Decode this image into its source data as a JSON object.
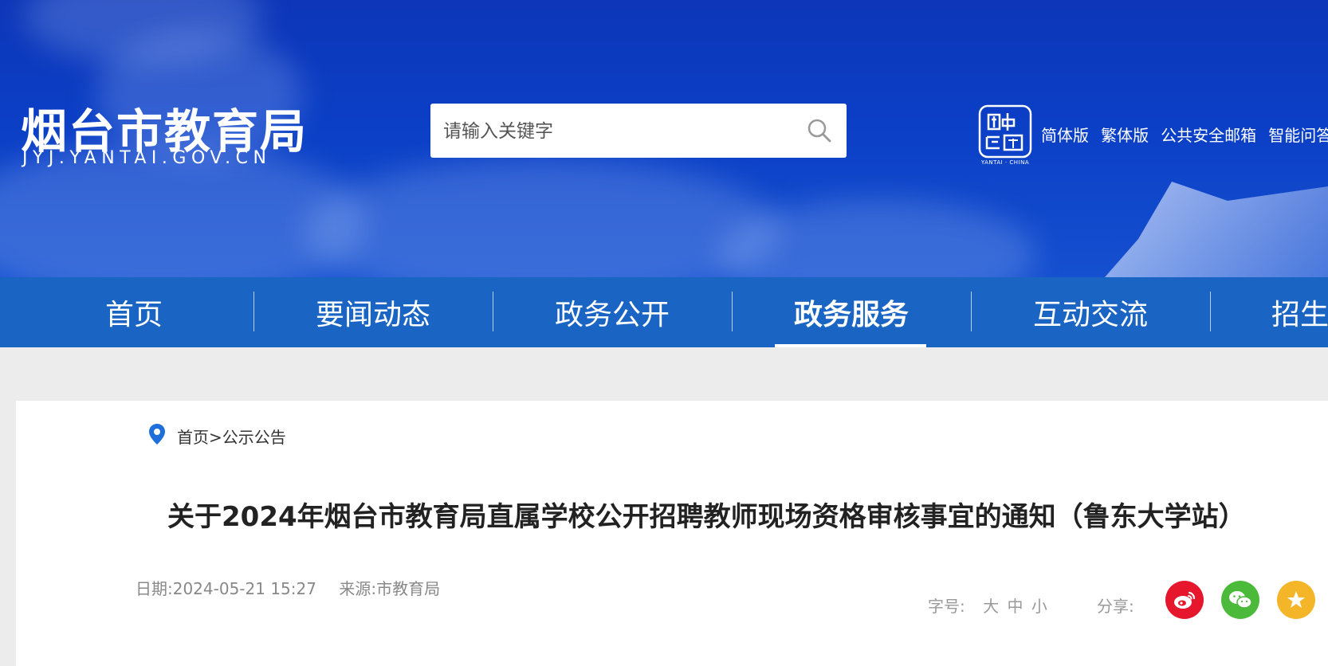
{
  "header": {
    "site_title": "烟台市教育局",
    "site_domain": "JYJ.YANTAI.GOV.CN",
    "search_placeholder": "请输入关键字",
    "seal_caption": "YANTAI · CHINA",
    "top_links": [
      "简体版",
      "繁体版",
      "公共安全邮箱",
      "智能问答"
    ]
  },
  "nav": {
    "items": [
      "首页",
      "要闻动态",
      "政务公开",
      "政务服务",
      "互动交流",
      "招生"
    ],
    "active": "政务服务"
  },
  "breadcrumb": {
    "home": "首页",
    "separator": ">",
    "current": "公示公告"
  },
  "article": {
    "title": "关于2024年烟台市教育局直属学校公开招聘教师现场资格审核事宜的通知（鲁东大学站）",
    "date": "日期:2024-05-21 15:27",
    "source": "来源:市教育局"
  },
  "tools": {
    "font_size_label": "字号:",
    "font_sizes": [
      "大",
      "中",
      "小"
    ],
    "share_label": "分享:",
    "share_icons": [
      "weibo-icon",
      "wechat-icon",
      "favorite-icon"
    ]
  },
  "colors": {
    "banner": "#0d36b8",
    "nav": "#1a64c4",
    "page_bg": "#ececec",
    "weibo": "#e6162d",
    "wechat": "#4bb93a",
    "favorite": "#f5b529"
  }
}
